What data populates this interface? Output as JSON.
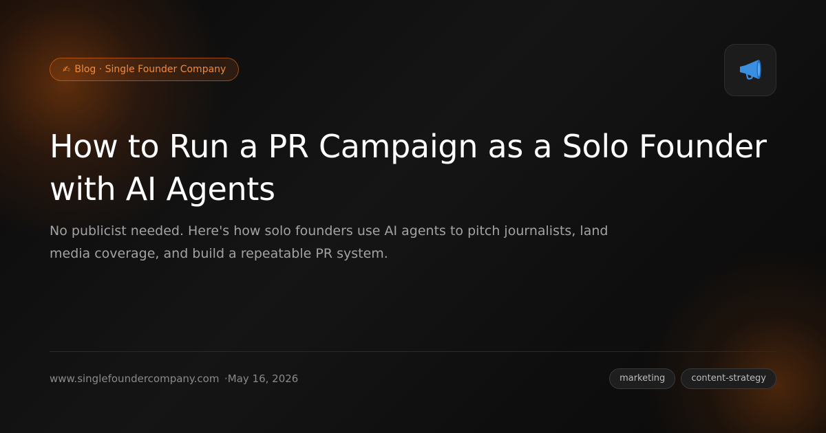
{
  "header": {
    "badge_icon": "✍",
    "badge_text": "Blog · Single Founder Company",
    "icon": "megaphone-icon",
    "icon_color": "#3b8fe0"
  },
  "article": {
    "title": "How to Run a PR Campaign as a Solo Founder with AI Agents",
    "subtitle": "No publicist needed. Here's how solo founders use AI agents to pitch journalists, land media coverage, and build a repeatable PR system."
  },
  "footer": {
    "url": "www.singlefoundercompany.com",
    "date": "·May 16, 2026",
    "tags": [
      "marketing",
      "content-strategy"
    ]
  },
  "colors": {
    "accent": "#f97316",
    "background": "#0b0b0b",
    "title": "#ffffff",
    "subtitle": "#a3a3a3"
  }
}
